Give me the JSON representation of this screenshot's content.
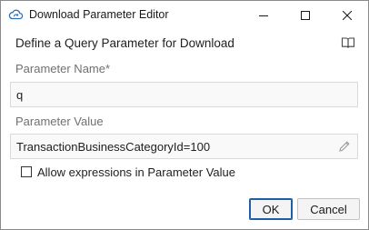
{
  "window": {
    "title": "Download Parameter Editor",
    "icon": "cloud-refresh-icon"
  },
  "dialog": {
    "heading": "Define a Query Parameter for Download",
    "help_icon": "book-icon",
    "parameter_name_label": "Parameter Name*",
    "parameter_name_value": "q",
    "parameter_value_label": "Parameter Value",
    "parameter_value_value": "TransactionBusinessCategoryId=100",
    "allow_expressions_label": "Allow expressions in Parameter Value",
    "allow_expressions_checked": false
  },
  "buttons": {
    "ok_label": "OK",
    "cancel_label": "Cancel"
  },
  "colors": {
    "accent_border": "#1f5fa8",
    "icon_blue": "#2f6fb5",
    "label_gray": "#707070"
  }
}
